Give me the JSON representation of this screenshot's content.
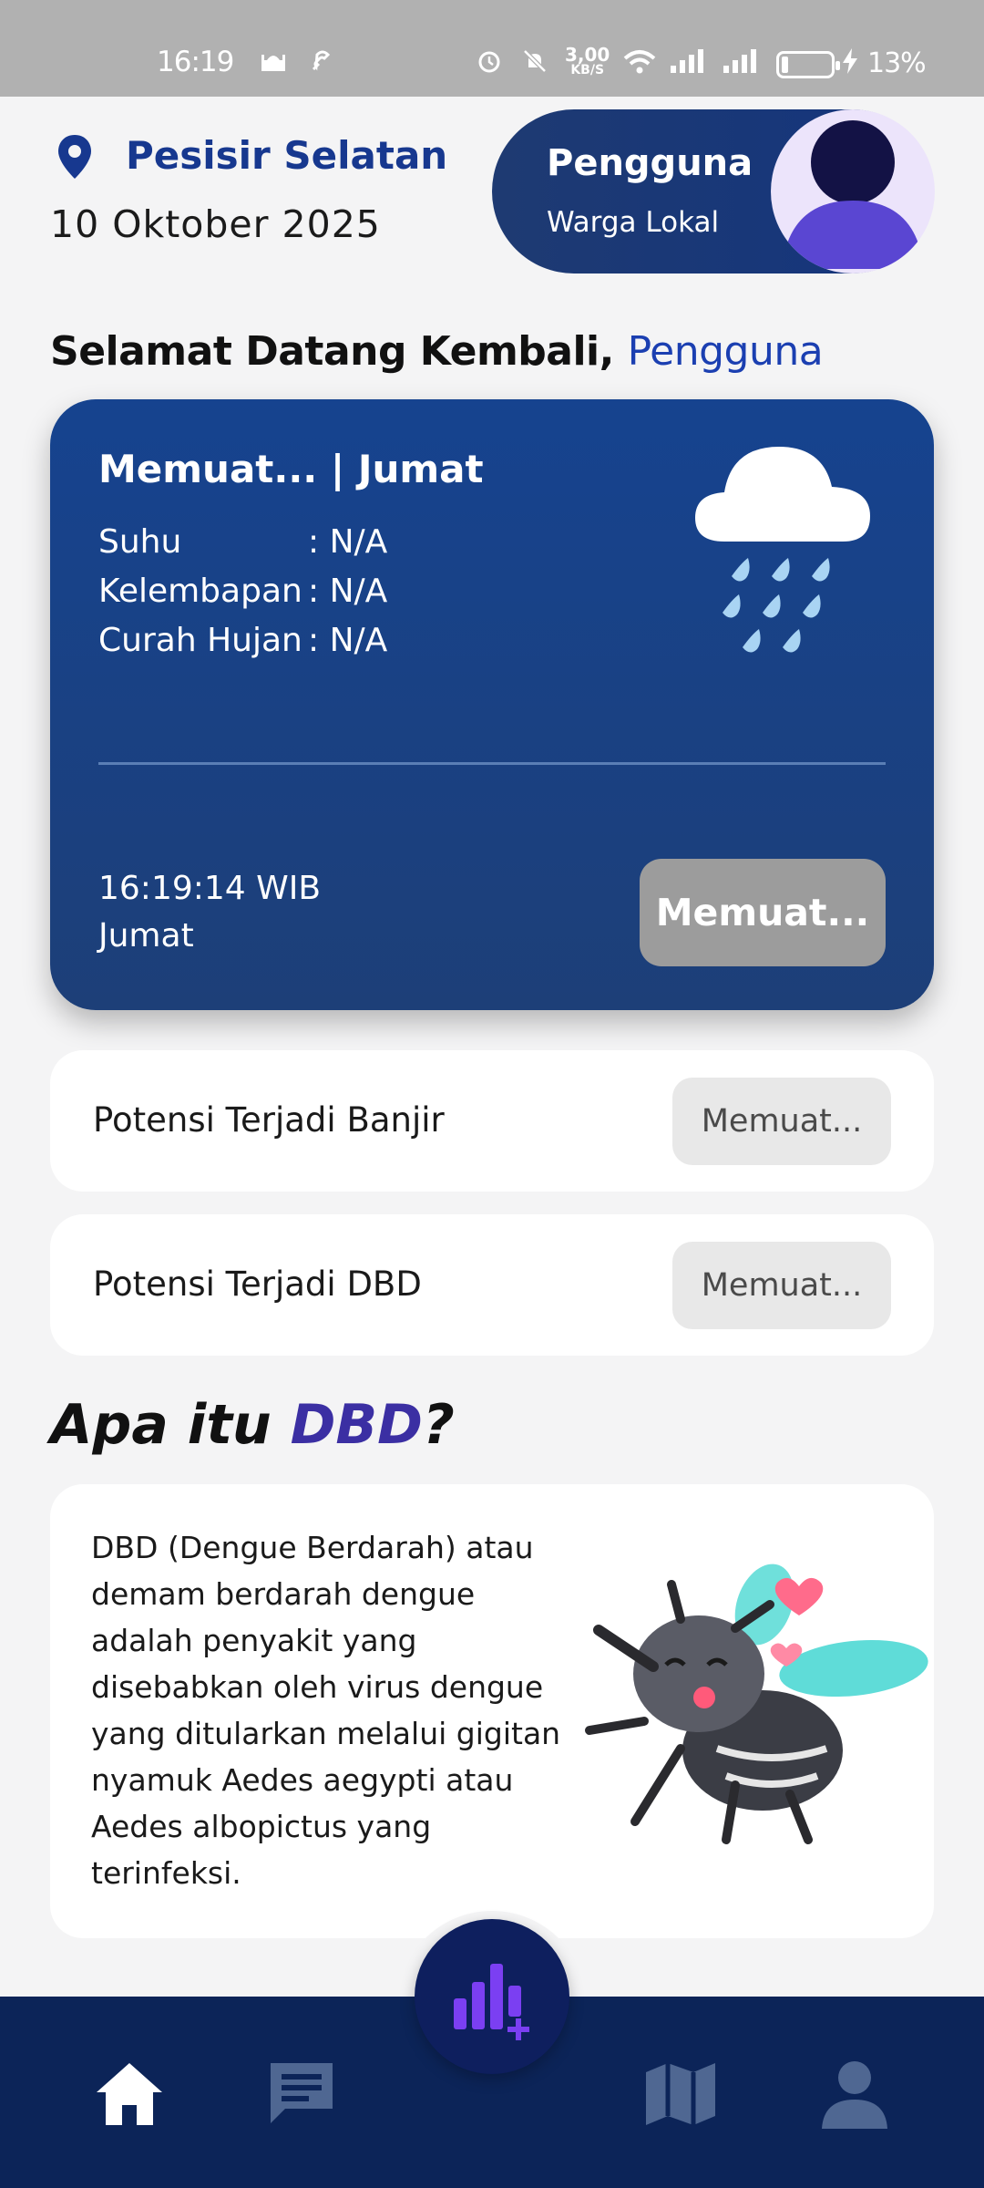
{
  "status_bar": {
    "time": "16:19",
    "net_speed_value": "3,00",
    "net_speed_unit": "KB/S",
    "battery": "13%"
  },
  "header": {
    "location": "Pesisir Selatan",
    "date": "10 Oktober 2025",
    "user_name": "Pengguna",
    "user_role": "Warga Lokal"
  },
  "welcome": {
    "prefix": "Selamat Datang Kembali, ",
    "name": "Pengguna"
  },
  "weather": {
    "heading": "Memuat... | Jumat",
    "rows": [
      {
        "label": "Suhu",
        "value": ": N/A"
      },
      {
        "label": "Kelembapan",
        "value": ": N/A"
      },
      {
        "label": "Curah Hujan",
        "value": ": N/A"
      }
    ],
    "time": "16:19:14 WIB",
    "day": "Jumat",
    "button_label": "Memuat..."
  },
  "potentials": [
    {
      "label": "Potensi Terjadi Banjir",
      "status": "Memuat..."
    },
    {
      "label": "Potensi Terjadi DBD",
      "status": "Memuat..."
    }
  ],
  "dbd": {
    "title_prefix": "Apa itu ",
    "title_highlight": "DBD",
    "title_suffix": "?",
    "description": "DBD (Dengue Berdarah) atau demam berdarah dengue adalah penyakit yang disebabkan oleh virus dengue yang ditularkan melalui gigitan nyamuk Aedes aegypti atau Aedes albopictus yang terinfeksi."
  },
  "colors": {
    "primary": "#14357d",
    "nav_bg": "#0c2458",
    "accent": "#7b3ff2",
    "nav_active": "#ffffff",
    "nav_inactive": "#4f6792"
  },
  "nav": {
    "items": [
      "home-icon",
      "chat-icon",
      "chart-add-icon",
      "map-icon",
      "profile-icon"
    ],
    "active": "home-icon"
  }
}
